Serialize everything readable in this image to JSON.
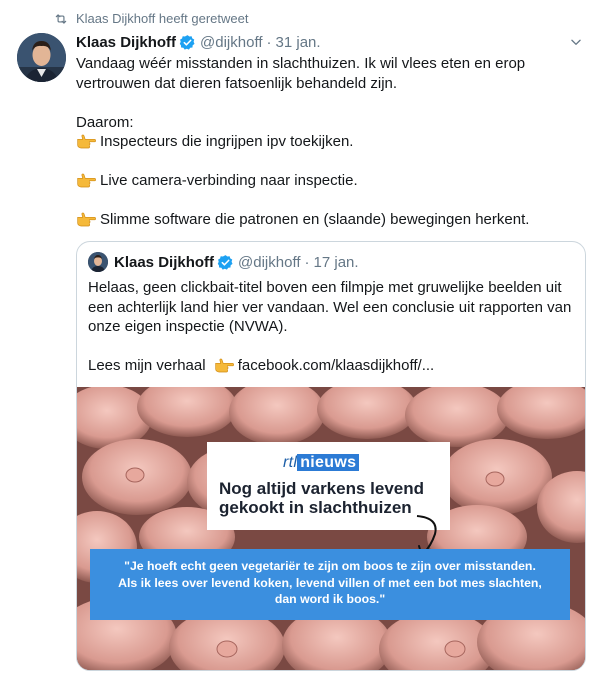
{
  "retweet": {
    "label": "Klaas Dijkhoff heeft geretweet"
  },
  "tweet": {
    "name": "Klaas Dijkhoff",
    "handle": "@dijkhoff",
    "separator": "·",
    "date": "31 jan.",
    "line1": "Vandaag wéér misstanden in slachthuizen. Ik wil vlees eten en erop",
    "line2": "vertrouwen dat dieren fatsoenlijk behandeld zijn.",
    "daarom": "Daarom:",
    "bullet1": "Inspecteurs die ingrijpen ipv toekijken.",
    "bullet2": "Live camera-verbinding naar inspectie.",
    "bullet3": "Slimme software die patronen en (slaande) bewegingen herkent."
  },
  "quote": {
    "name": "Klaas Dijkhoff",
    "handle": "@dijkhoff",
    "separator": "·",
    "date": "17 jan.",
    "line1": "Helaas, geen clickbait-titel boven een filmpje met gruwelijke beelden uit",
    "line2": "een achterlijk land hier ver vandaan. Wel een conclusie uit rapporten van",
    "line3": "onze eigen inspectie (NVWA).",
    "read_prefix": "Lees mijn verhaal",
    "link": "facebook.com/klaasdijkhoff/..."
  },
  "media": {
    "logo_rtl": "rtl",
    "logo_nieuws": "nieuws",
    "headline_line1": "Nog altijd varkens levend",
    "headline_line2": "gekookt in slachthuizen",
    "quote_line1": "\"Je hoeft echt geen vegetariër te zijn om boos te zijn over misstanden.",
    "quote_line2": "Als ik lees over levend koken, levend villen of met een bot mes slachten,",
    "quote_line3": "dan word ik boos.\""
  },
  "colors": {
    "verified": "#1da1f2",
    "secondary_text": "#657786",
    "quote_box": "#3b8fdf",
    "border": "#ccd6dd"
  },
  "icons": {
    "retweet": "retweet-icon",
    "verified": "verified-badge-icon",
    "menu": "chevron-down-icon",
    "pointing_hand": "pointing-right-hand-emoji"
  }
}
